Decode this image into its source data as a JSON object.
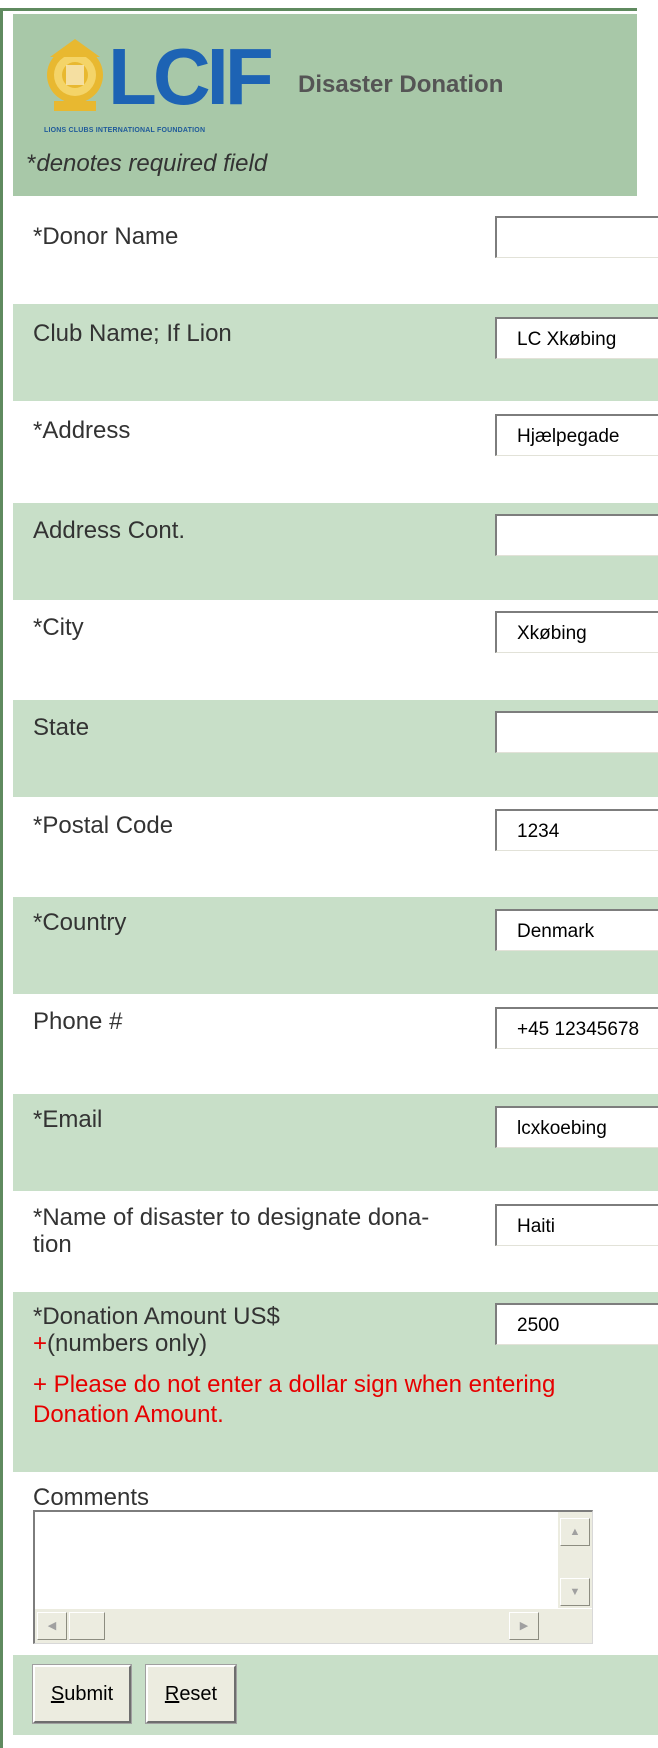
{
  "header": {
    "logo_text": "LCIF",
    "logo_caption": "LIONS CLUBS INTERNATIONAL FOUNDATION",
    "title": "Disaster Donation",
    "required_note": "denotes required field",
    "required_marker": "*"
  },
  "fields": [
    {
      "label": "*Donor Name",
      "value": ""
    },
    {
      "label": "Club Name; If Lion",
      "value": "LC Xkøbing"
    },
    {
      "label": "*Address",
      "value": "Hjælpegade"
    },
    {
      "label": "Address Cont.",
      "value": ""
    },
    {
      "label": "*City",
      "value": "Xkøbing"
    },
    {
      "label": "State",
      "value": ""
    },
    {
      "label": "*Postal Code",
      "value": "1234"
    },
    {
      "label": "*Country",
      "value": "Denmark"
    },
    {
      "label": "Phone #",
      "value": "+45 12345678"
    },
    {
      "label": "*Email",
      "value": "lcxkoebing"
    },
    {
      "label_line1": "*Name of disaster to designate dona-",
      "label_line2": "tion",
      "value": "Haiti"
    }
  ],
  "donation": {
    "label_line1": "*Donation Amount US$",
    "plus": "+",
    "label_line2": "(numbers only)",
    "value": "2500",
    "warning": "+ Please do not enter a dollar sign when entering Donation Amount."
  },
  "comments": {
    "label": "Comments",
    "value": ""
  },
  "buttons": {
    "submit_first": "S",
    "submit_rest": "ubmit",
    "reset_first": "R",
    "reset_rest": "eset"
  },
  "colors": {
    "header_bg": "#a8c8a8",
    "row_alt_bg": "#c8dfc8",
    "warning": "#e60000",
    "logo_blue": "#1d63b4",
    "logo_gold": "#e8b830"
  }
}
